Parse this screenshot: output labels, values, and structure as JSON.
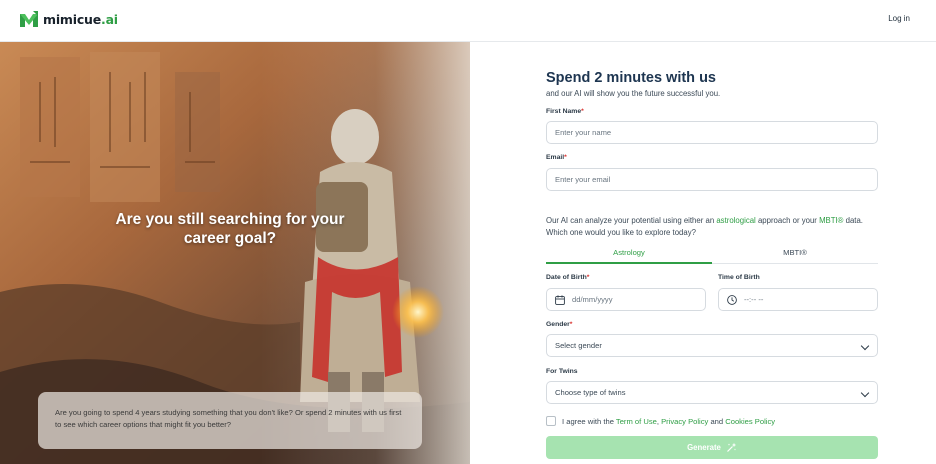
{
  "header": {
    "logo_text": "mimicue",
    "logo_suffix": ".ai",
    "login_label": "Log in"
  },
  "hero": {
    "headline": "Are you still searching for your career goal?",
    "card_text": "Are you going to spend 4 years studying something that you don't like? Or spend 2 minutes with us first to see which career options that might fit you better?"
  },
  "form": {
    "title": "Spend 2 minutes with us",
    "subtitle": "and our AI will show you the future successful you.",
    "first_name": {
      "label": "First Name",
      "placeholder": "Enter your name"
    },
    "email": {
      "label": "Email",
      "placeholder": "Enter your email"
    },
    "intro": {
      "part1": "Our AI can analyze your potential using either an ",
      "link1": "astrological",
      "part2": " approach or your ",
      "link2": "MBTI®",
      "part3": " data. Which one would you like to explore today?"
    },
    "tabs": [
      {
        "label": "Astrology",
        "active": true
      },
      {
        "label": "MBTI®",
        "active": false
      }
    ],
    "dob": {
      "label": "Date of Birth",
      "placeholder": "dd/mm/yyyy"
    },
    "tob": {
      "label": "Time of Birth",
      "placeholder": "--:-- --"
    },
    "gender": {
      "label": "Gender",
      "value": "Select gender"
    },
    "twins": {
      "label": "For Twins",
      "value": "Choose type of twins"
    },
    "consent": {
      "prefix": "I agree with the ",
      "terms": "Term of Use",
      "sep": ", ",
      "privacy": "Privacy Policy",
      "and": " and ",
      "cookies": "Cookies Policy"
    },
    "generate_label": "Generate",
    "required_mark": "*"
  },
  "colors": {
    "accent": "#2f9e45",
    "button_disabled": "#a6e3b0",
    "title": "#1d3550"
  }
}
